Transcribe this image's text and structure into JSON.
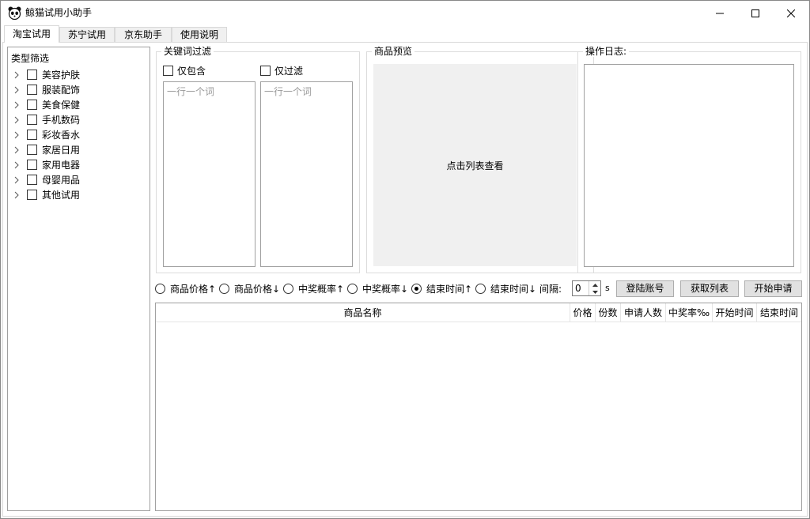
{
  "window": {
    "title": "鲸猫试用小助手"
  },
  "tabs": [
    {
      "label": "淘宝试用",
      "active": true
    },
    {
      "label": "苏宁试用",
      "active": false
    },
    {
      "label": "京东助手",
      "active": false
    },
    {
      "label": "使用说明",
      "active": false
    }
  ],
  "category_filter": {
    "title": "类型筛选",
    "items": [
      {
        "label": "美容护肤",
        "checked": false
      },
      {
        "label": "服装配饰",
        "checked": false
      },
      {
        "label": "美食保健",
        "checked": false
      },
      {
        "label": "手机数码",
        "checked": false
      },
      {
        "label": "彩妆香水",
        "checked": false
      },
      {
        "label": "家居日用",
        "checked": false
      },
      {
        "label": "家用电器",
        "checked": false
      },
      {
        "label": "母婴用品",
        "checked": false
      },
      {
        "label": "其他试用",
        "checked": false
      }
    ]
  },
  "keyword_filter": {
    "title": "关键词过滤",
    "include_label": "仅包含",
    "exclude_label": "仅过滤",
    "include_placeholder": "一行一个词",
    "exclude_placeholder": "一行一个词"
  },
  "preview": {
    "title": "商品预览",
    "hint": "点击列表查看"
  },
  "log": {
    "title": "操作日志:"
  },
  "sort_options": [
    {
      "label": "商品价格↑",
      "selected": false
    },
    {
      "label": "商品价格↓",
      "selected": false
    },
    {
      "label": "中奖概率↑",
      "selected": false
    },
    {
      "label": "中奖概率↓",
      "selected": false
    },
    {
      "label": "结束时间↑",
      "selected": true
    },
    {
      "label": "结束时间↓",
      "selected": false
    }
  ],
  "interval": {
    "label": "间隔:",
    "value": "0",
    "unit": "s"
  },
  "buttons": {
    "login": "登陆账号",
    "fetch": "获取列表",
    "start": "开始申请"
  },
  "table": {
    "columns": [
      "商品名称",
      "价格",
      "份数",
      "申请人数",
      "中奖率‰",
      "开始时间",
      "结束时间"
    ],
    "rows": []
  }
}
